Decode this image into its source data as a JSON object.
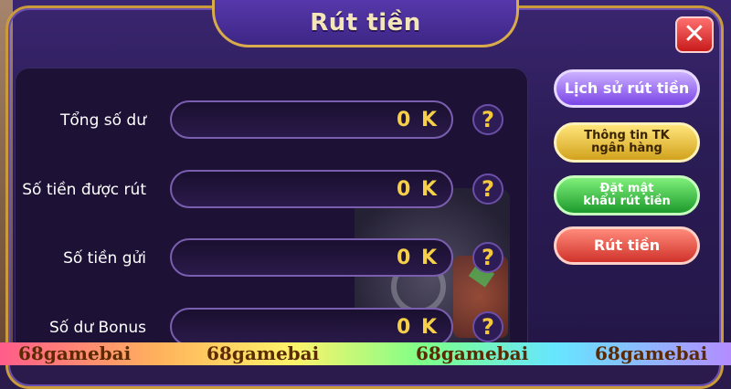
{
  "dialog": {
    "title": "Rút tiền",
    "close_icon": "close-x-icon"
  },
  "fields": [
    {
      "label": "Tổng số dư",
      "value": "0 K"
    },
    {
      "label": "Số tiền được rút",
      "value": "0 K"
    },
    {
      "label": "Số tiền gửi",
      "value": "0 K"
    },
    {
      "label": "Số dư Bonus",
      "value": "0 K"
    }
  ],
  "help": {
    "symbol": "?"
  },
  "side_menu": {
    "history": "Lịch sử rút tiền",
    "bank_info_line1": "Thông tin TK",
    "bank_info_line2": "ngân hàng",
    "set_password_line1": "Đặt mật",
    "set_password_line2": "khẩu rút tiền",
    "withdraw": "Rút tiền"
  },
  "watermarks": [
    "68gamebai",
    "68gamebai",
    "68gamebai",
    "68gamebai"
  ],
  "colors": {
    "frame_gold": "#c99b3a",
    "value_yellow": "#f6d04a",
    "history_purple": "#7a45e6",
    "bank_gold": "#d2a21d",
    "password_green": "#1c9a2c",
    "withdraw_red": "#d0322a",
    "close_red": "#c81b1b"
  }
}
